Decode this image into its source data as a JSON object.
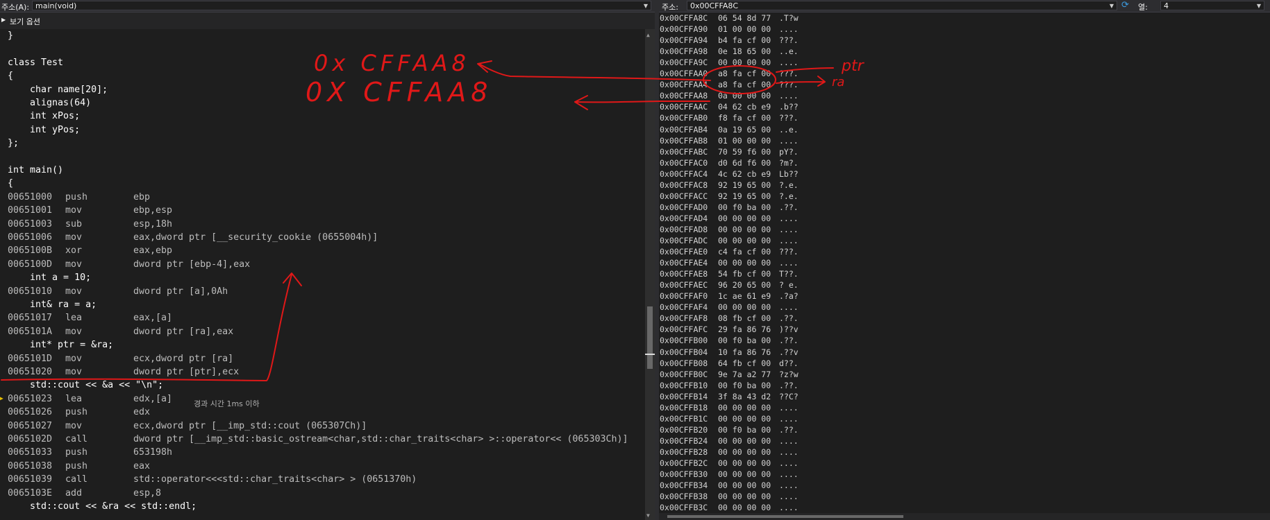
{
  "left_toolbar": {
    "address_label": "주소(A):",
    "address_value": "main(void)"
  },
  "view_options": "보기 옵션",
  "code_lines": [
    {
      "src": "}"
    },
    {
      "src": ""
    },
    {
      "src": "class Test"
    },
    {
      "src": "{"
    },
    {
      "src": "    char name[20];"
    },
    {
      "src": "    alignas(64)"
    },
    {
      "src": "    int xPos;"
    },
    {
      "src": "    int yPos;"
    },
    {
      "src": "};"
    },
    {
      "src": ""
    },
    {
      "src": "int main()"
    },
    {
      "src": "{"
    },
    {
      "addr": "00651000",
      "mn": "push",
      "op": "ebp"
    },
    {
      "addr": "00651001",
      "mn": "mov",
      "op": "ebp,esp"
    },
    {
      "addr": "00651003",
      "mn": "sub",
      "op": "esp,18h"
    },
    {
      "addr": "00651006",
      "mn": "mov",
      "op": "eax,dword ptr [__security_cookie (0655004h)]"
    },
    {
      "addr": "0065100B",
      "mn": "xor",
      "op": "eax,ebp"
    },
    {
      "addr": "0065100D",
      "mn": "mov",
      "op": "dword ptr [ebp-4],eax"
    },
    {
      "src": "    int a = 10;"
    },
    {
      "addr": "00651010",
      "mn": "mov",
      "op": "dword ptr [a],0Ah"
    },
    {
      "src": "    int& ra = a;"
    },
    {
      "addr": "00651017",
      "mn": "lea",
      "op": "eax,[a]"
    },
    {
      "addr": "0065101A",
      "mn": "mov",
      "op": "dword ptr [ra],eax"
    },
    {
      "src": "    int* ptr = &ra;"
    },
    {
      "addr": "0065101D",
      "mn": "mov",
      "op": "ecx,dword ptr [ra]"
    },
    {
      "addr": "00651020",
      "mn": "mov",
      "op": "dword ptr [ptr],ecx"
    },
    {
      "src": "    std::cout << &a << \"\\n\";"
    },
    {
      "addr": "00651023",
      "mn": "lea",
      "op": "edx,[a]"
    },
    {
      "addr": "00651026",
      "mn": "push",
      "op": "edx"
    },
    {
      "addr": "00651027",
      "mn": "mov",
      "op": "ecx,dword ptr [__imp_std::cout (065307Ch)]"
    },
    {
      "addr": "0065102D",
      "mn": "call",
      "op": "dword ptr [__imp_std::basic_ostream<char,std::char_traits<char> >::operator<< (065303Ch)]"
    },
    {
      "addr": "00651033",
      "mn": "push",
      "op": "653198h"
    },
    {
      "addr": "00651038",
      "mn": "push",
      "op": "eax"
    },
    {
      "addr": "00651039",
      "mn": "call",
      "op": "std::operator<<<std::char_traits<char> > (0651370h)"
    },
    {
      "addr": "0065103E",
      "mn": "add",
      "op": "esp,8"
    },
    {
      "src": "    std::cout << &ra << std::endl;"
    }
  ],
  "elapsed_note": "경과 시간 1ms 이하",
  "right_toolbar": {
    "address_label": "주소:",
    "address_value": "0x00CFFA8C",
    "columns_label": "열:",
    "columns_value": "4"
  },
  "memory_rows": [
    {
      "a": "0x00CFFA8C",
      "b": "06 54 8d 77",
      "c": ".T?w"
    },
    {
      "a": "0x00CFFA90",
      "b": "01 00 00 00",
      "c": "...."
    },
    {
      "a": "0x00CFFA94",
      "b": "b4 fa cf 00",
      "c": "???."
    },
    {
      "a": "0x00CFFA98",
      "b": "0e 18 65 00",
      "c": "..e."
    },
    {
      "a": "0x00CFFA9C",
      "b": "00 00 00 00",
      "c": "...."
    },
    {
      "a": "0x00CFFAA0",
      "b": "a8 fa cf 00",
      "c": "???."
    },
    {
      "a": "0x00CFFAA4",
      "b": "a8 fa cf 00",
      "c": "???."
    },
    {
      "a": "0x00CFFAA8",
      "b": "0a 00 00 00",
      "c": "...."
    },
    {
      "a": "0x00CFFAAC",
      "b": "04 62 cb e9",
      "c": ".b??"
    },
    {
      "a": "0x00CFFAB0",
      "b": "f8 fa cf 00",
      "c": "???."
    },
    {
      "a": "0x00CFFAB4",
      "b": "0a 19 65 00",
      "c": "..e."
    },
    {
      "a": "0x00CFFAB8",
      "b": "01 00 00 00",
      "c": "...."
    },
    {
      "a": "0x00CFFABC",
      "b": "70 59 f6 00",
      "c": "pY?."
    },
    {
      "a": "0x00CFFAC0",
      "b": "d0 6d f6 00",
      "c": "?m?."
    },
    {
      "a": "0x00CFFAC4",
      "b": "4c 62 cb e9",
      "c": "Lb??"
    },
    {
      "a": "0x00CFFAC8",
      "b": "92 19 65 00",
      "c": "?.e."
    },
    {
      "a": "0x00CFFACC",
      "b": "92 19 65 00",
      "c": "?.e."
    },
    {
      "a": "0x00CFFAD0",
      "b": "00 f0 ba 00",
      "c": ".??."
    },
    {
      "a": "0x00CFFAD4",
      "b": "00 00 00 00",
      "c": "...."
    },
    {
      "a": "0x00CFFAD8",
      "b": "00 00 00 00",
      "c": "...."
    },
    {
      "a": "0x00CFFADC",
      "b": "00 00 00 00",
      "c": "...."
    },
    {
      "a": "0x00CFFAE0",
      "b": "c4 fa cf 00",
      "c": "???."
    },
    {
      "a": "0x00CFFAE4",
      "b": "00 00 00 00",
      "c": "...."
    },
    {
      "a": "0x00CFFAE8",
      "b": "54 fb cf 00",
      "c": "T??."
    },
    {
      "a": "0x00CFFAEC",
      "b": "96 20 65 00",
      "c": "? e."
    },
    {
      "a": "0x00CFFAF0",
      "b": "1c ae 61 e9",
      "c": ".?a?"
    },
    {
      "a": "0x00CFFAF4",
      "b": "00 00 00 00",
      "c": "...."
    },
    {
      "a": "0x00CFFAF8",
      "b": "08 fb cf 00",
      "c": ".??."
    },
    {
      "a": "0x00CFFAFC",
      "b": "29 fa 86 76",
      "c": ")??v"
    },
    {
      "a": "0x00CFFB00",
      "b": "00 f0 ba 00",
      "c": ".??."
    },
    {
      "a": "0x00CFFB04",
      "b": "10 fa 86 76",
      "c": ".??v"
    },
    {
      "a": "0x00CFFB08",
      "b": "64 fb cf 00",
      "c": "d??."
    },
    {
      "a": "0x00CFFB0C",
      "b": "9e 7a a2 77",
      "c": "?z?w"
    },
    {
      "a": "0x00CFFB10",
      "b": "00 f0 ba 00",
      "c": ".??."
    },
    {
      "a": "0x00CFFB14",
      "b": "3f 8a 43 d2",
      "c": "??C?"
    },
    {
      "a": "0x00CFFB18",
      "b": "00 00 00 00",
      "c": "...."
    },
    {
      "a": "0x00CFFB1C",
      "b": "00 00 00 00",
      "c": "...."
    },
    {
      "a": "0x00CFFB20",
      "b": "00 f0 ba 00",
      "c": ".??."
    },
    {
      "a": "0x00CFFB24",
      "b": "00 00 00 00",
      "c": "...."
    },
    {
      "a": "0x00CFFB28",
      "b": "00 00 00 00",
      "c": "...."
    },
    {
      "a": "0x00CFFB2C",
      "b": "00 00 00 00",
      "c": "...."
    },
    {
      "a": "0x00CFFB30",
      "b": "00 00 00 00",
      "c": "...."
    },
    {
      "a": "0x00CFFB34",
      "b": "00 00 00 00",
      "c": "...."
    },
    {
      "a": "0x00CFFB38",
      "b": "00 00 00 00",
      "c": "...."
    },
    {
      "a": "0x00CFFB3C",
      "b": "00 00 00 00",
      "c": "...."
    }
  ],
  "annotations": {
    "line1": "0x CFFAA8",
    "line2": "0X CFFAA8",
    "ptr_note": "ptr",
    "ra_note": "ra"
  },
  "colors": {
    "ink": "#e01818",
    "background": "#1e1e1e",
    "toolbar": "#2d2d30"
  }
}
